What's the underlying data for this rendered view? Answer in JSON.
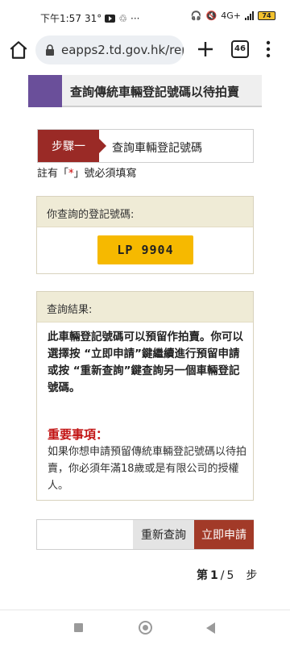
{
  "status_bar": {
    "time": "下午1:57",
    "temperature": "31°",
    "network": "4G+",
    "battery": "74"
  },
  "browser": {
    "url": "eapps2.td.gov.hk/repo",
    "tab_count": "46"
  },
  "page": {
    "title": "查詢傳統車輛登記號碼以待拍賣",
    "step_label": "步驟一",
    "step_text": "查詢車輛登記號碼",
    "required_note_prefix": "註有「",
    "required_note_star": "*",
    "required_note_suffix": "」號必須填寫",
    "reg_panel_heading": "你查詢的登記號碼:",
    "plate_number": "LP 9904",
    "result_panel_heading": "查詢結果:",
    "result_text": "此車輛登記號碼可以預留作拍賣。你可以選擇按 “立即申請”鍵繼續進行預留申請或按 “重新查詢”鍵查詢另一個車輛登記號碼。",
    "important_title": "重要事項：",
    "important_text": "如果你想申請預留傳統車輛登記號碼以待拍賣，你必須年滿18歲或是有限公司的授權人。",
    "requery_button": "重新查詢",
    "apply_button": "立即申請",
    "pager": {
      "prefix": "第",
      "current": "1",
      "sep": "/",
      "total": "5",
      "suffix": "步"
    }
  },
  "colors": {
    "title_accent": "#6a4f9a",
    "step_label": "#9a2a26",
    "plate": "#f6b900",
    "apply_button": "#a23a28",
    "important": "#c21414"
  }
}
